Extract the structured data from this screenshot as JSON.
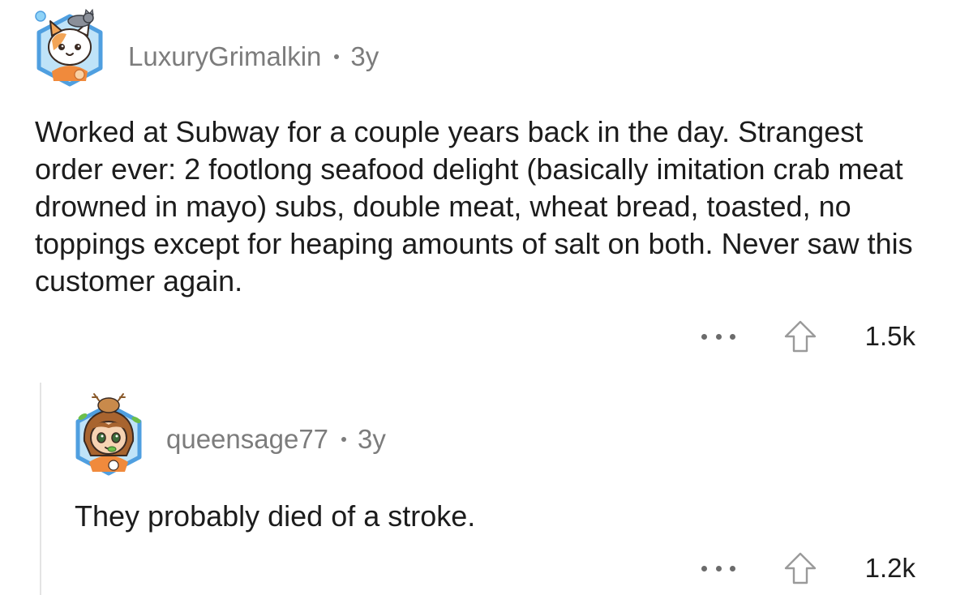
{
  "comment": {
    "username": "LuxuryGrimalkin",
    "separator": "•",
    "age": "3y",
    "body": "Worked at Subway for a couple years back in the day. Strangest order ever: 2 footlong seafood delight (basically imitation crab meat drowned in mayo) subs, double meat, wheat bread, toasted, no toppings except for heaping amounts of salt on both. Never saw this customer again.",
    "more_icon": "more-horizontal-icon",
    "upvote_icon": "upvote-arrow-icon",
    "votes": "1.5k"
  },
  "reply": {
    "username": "queensage77",
    "separator": "•",
    "age": "3y",
    "body": "They probably died of a stroke.",
    "more_icon": "more-horizontal-icon",
    "upvote_icon": "upvote-arrow-icon",
    "votes": "1.2k"
  },
  "colors": {
    "meta_text": "#7c7c7c",
    "body_text": "#1c1c1c",
    "thread_line": "#e4e4e4",
    "avatar_hex_border": "#4f9fe0"
  }
}
